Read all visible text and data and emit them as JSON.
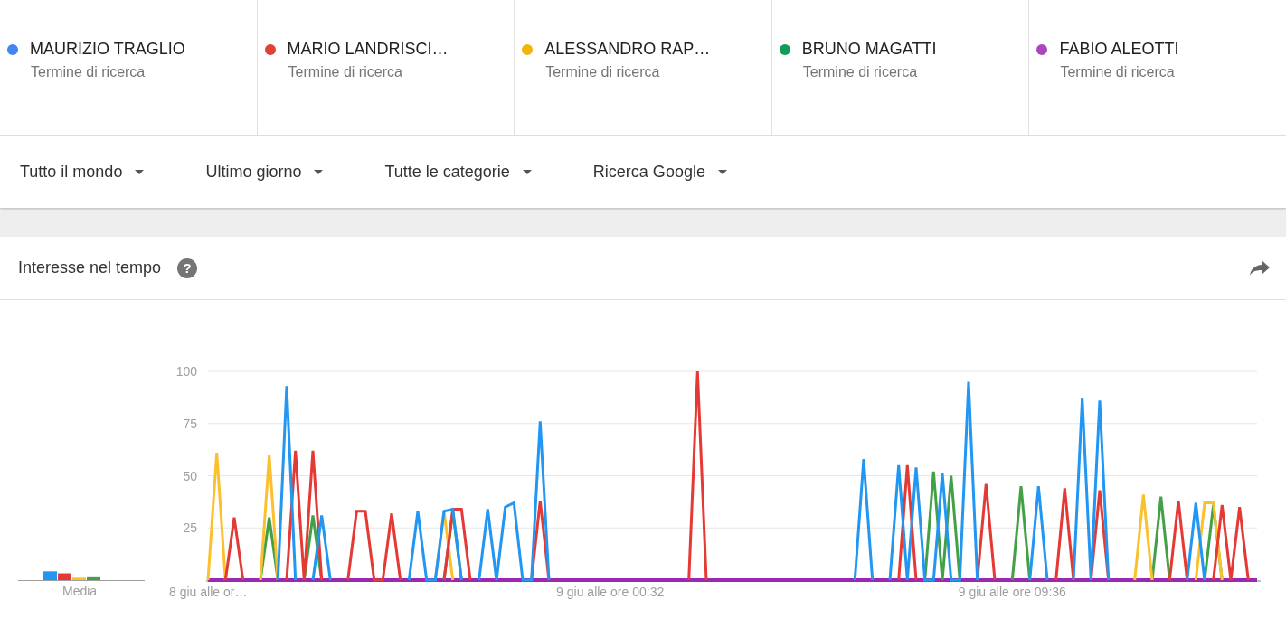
{
  "terms": [
    {
      "name": "MAURIZIO TRAGLIO",
      "subtitle": "Termine di ricerca",
      "color": "#4285f4"
    },
    {
      "name": "MARIO LANDRISCI…",
      "subtitle": "Termine di ricerca",
      "color": "#db4437"
    },
    {
      "name": "ALESSANDRO RAP…",
      "subtitle": "Termine di ricerca",
      "color": "#f4b400"
    },
    {
      "name": "BRUNO MAGATTI",
      "subtitle": "Termine di ricerca",
      "color": "#0f9d58"
    },
    {
      "name": "FABIO ALEOTTI",
      "subtitle": "Termine di ricerca",
      "color": "#ab47bc"
    }
  ],
  "filters": [
    "Tutto il mondo",
    "Ultimo giorno",
    "Tutte le categorie",
    "Ricerca Google"
  ],
  "panel": {
    "title": "Interesse nel tempo",
    "help_glyph": "?",
    "average_label": "Media",
    "chart_data": {
      "type": "line",
      "grid": true,
      "ylim": [
        0,
        100
      ],
      "yticks": [
        25,
        50,
        75,
        100
      ],
      "categories": [
        "8 giu alle or…",
        null,
        null,
        null,
        null,
        null,
        null,
        null,
        null,
        null,
        null,
        null,
        null,
        null,
        null,
        null,
        null,
        null,
        null,
        null,
        null,
        null,
        null,
        null,
        null,
        null,
        null,
        null,
        null,
        null,
        null,
        null,
        null,
        null,
        null,
        null,
        null,
        null,
        null,
        null,
        null,
        null,
        null,
        null,
        null,
        null,
        "9 giu alle ore 00:32",
        null,
        null,
        null,
        null,
        null,
        null,
        null,
        null,
        null,
        null,
        null,
        null,
        null,
        null,
        null,
        null,
        null,
        null,
        null,
        null,
        null,
        null,
        null,
        null,
        null,
        null,
        null,
        null,
        null,
        null,
        null,
        null,
        null,
        null,
        null,
        null,
        null,
        null,
        null,
        null,
        null,
        null,
        null,
        null,
        null,
        "9 giu alle ore 09:36",
        null,
        null,
        null,
        null,
        null,
        null,
        null,
        null,
        null,
        null,
        null,
        null,
        null,
        null,
        null,
        null,
        null,
        null,
        null,
        null,
        null,
        null,
        null,
        null,
        null,
        null,
        null,
        null
      ],
      "series": [
        {
          "color": "#2196f3",
          "values": [
            null,
            null,
            null,
            null,
            null,
            null,
            null,
            null,
            0,
            93,
            0,
            null,
            0,
            31,
            0,
            null,
            null,
            null,
            null,
            null,
            null,
            null,
            null,
            0,
            33,
            0,
            0,
            33,
            34,
            0,
            null,
            0,
            34,
            0,
            35,
            37,
            0,
            0,
            76,
            0,
            null,
            null,
            null,
            null,
            null,
            null,
            null,
            null,
            null,
            null,
            null,
            null,
            null,
            null,
            null,
            null,
            null,
            null,
            null,
            null,
            null,
            null,
            null,
            null,
            null,
            null,
            null,
            null,
            null,
            null,
            null,
            null,
            null,
            null,
            0,
            58,
            0,
            null,
            0,
            55,
            0,
            54,
            0,
            0,
            51,
            0,
            0,
            95,
            0,
            null,
            null,
            null,
            null,
            null,
            0,
            45,
            0,
            null,
            null,
            0,
            87,
            0,
            86,
            0,
            null,
            null,
            null,
            null,
            null,
            null,
            null,
            null,
            0,
            37,
            0,
            null,
            null,
            null,
            null,
            null,
            null
          ]
        },
        {
          "color": "#e53935",
          "values": [
            null,
            null,
            0,
            30,
            0,
            null,
            null,
            null,
            null,
            0,
            62,
            0,
            62,
            0,
            null,
            null,
            0,
            33,
            33,
            0,
            0,
            32,
            0,
            null,
            null,
            null,
            null,
            0,
            34,
            34,
            0,
            null,
            null,
            null,
            null,
            null,
            null,
            0,
            38,
            0,
            null,
            null,
            null,
            null,
            null,
            null,
            null,
            null,
            null,
            null,
            null,
            null,
            null,
            null,
            null,
            0,
            100,
            0,
            null,
            null,
            null,
            null,
            null,
            null,
            null,
            null,
            null,
            null,
            null,
            null,
            null,
            null,
            null,
            null,
            null,
            null,
            null,
            null,
            null,
            0,
            55,
            0,
            null,
            null,
            null,
            null,
            null,
            null,
            0,
            46,
            0,
            null,
            null,
            null,
            null,
            null,
            null,
            0,
            44,
            0,
            null,
            0,
            43,
            0,
            null,
            null,
            null,
            null,
            null,
            null,
            0,
            38,
            0,
            null,
            null,
            0,
            36,
            0,
            35,
            0,
            null
          ]
        },
        {
          "color": "#fbc02d",
          "values": [
            0,
            61,
            0,
            null,
            null,
            null,
            0,
            60,
            0,
            null,
            null,
            null,
            null,
            null,
            null,
            null,
            null,
            null,
            null,
            null,
            null,
            null,
            null,
            null,
            null,
            null,
            0,
            33,
            0,
            null,
            null,
            null,
            null,
            null,
            null,
            null,
            null,
            null,
            null,
            null,
            null,
            null,
            null,
            null,
            null,
            null,
            null,
            null,
            null,
            null,
            null,
            null,
            null,
            null,
            null,
            null,
            null,
            null,
            null,
            null,
            null,
            null,
            null,
            null,
            null,
            null,
            null,
            null,
            null,
            null,
            null,
            null,
            null,
            null,
            null,
            null,
            null,
            null,
            null,
            null,
            null,
            null,
            null,
            null,
            null,
            null,
            null,
            null,
            null,
            null,
            null,
            null,
            null,
            null,
            null,
            null,
            null,
            null,
            null,
            null,
            null,
            null,
            null,
            null,
            null,
            null,
            0,
            41,
            0,
            null,
            null,
            null,
            null,
            0,
            37,
            37,
            0,
            null,
            null,
            null,
            null
          ]
        },
        {
          "color": "#43a047",
          "values": [
            null,
            null,
            null,
            null,
            null,
            null,
            0,
            30,
            0,
            null,
            null,
            0,
            31,
            0,
            null,
            null,
            null,
            null,
            null,
            null,
            null,
            null,
            null,
            null,
            null,
            null,
            null,
            0,
            33,
            0,
            null,
            null,
            null,
            null,
            null,
            null,
            null,
            null,
            null,
            null,
            null,
            null,
            null,
            null,
            null,
            null,
            null,
            null,
            null,
            null,
            null,
            null,
            null,
            null,
            null,
            null,
            null,
            null,
            null,
            null,
            null,
            null,
            null,
            null,
            null,
            null,
            null,
            null,
            null,
            null,
            null,
            null,
            null,
            null,
            null,
            null,
            null,
            null,
            null,
            null,
            null,
            null,
            0,
            52,
            0,
            50,
            0,
            null,
            null,
            null,
            null,
            null,
            0,
            45,
            0,
            null,
            null,
            null,
            null,
            null,
            null,
            null,
            null,
            null,
            null,
            null,
            null,
            null,
            0,
            40,
            0,
            null,
            null,
            null,
            0,
            36,
            0,
            null,
            null,
            null,
            null
          ]
        },
        {
          "color": "#9c27b0",
          "values": [
            0,
            0,
            0,
            0,
            0,
            0,
            0,
            0,
            0,
            0,
            0,
            0,
            0,
            0,
            0,
            0,
            0,
            0,
            0,
            0,
            0,
            0,
            0,
            0,
            0,
            0,
            0,
            0,
            0,
            0,
            0,
            0,
            0,
            0,
            0,
            0,
            0,
            0,
            0,
            0,
            0,
            0,
            0,
            0,
            0,
            0,
            0,
            0,
            0,
            0,
            0,
            0,
            0,
            0,
            0,
            0,
            0,
            0,
            0,
            0,
            0,
            0,
            0,
            0,
            0,
            0,
            0,
            0,
            0,
            0,
            0,
            0,
            0,
            0,
            0,
            0,
            0,
            0,
            0,
            0,
            0,
            0,
            0,
            0,
            0,
            0,
            0,
            0,
            0,
            0,
            0,
            0,
            0,
            0,
            0,
            0,
            0,
            0,
            0,
            0,
            0,
            0,
            0,
            0,
            0,
            0,
            0,
            0,
            0,
            0,
            0,
            0,
            0,
            0,
            0,
            0,
            0,
            0,
            0,
            0,
            0
          ]
        }
      ]
    }
  }
}
